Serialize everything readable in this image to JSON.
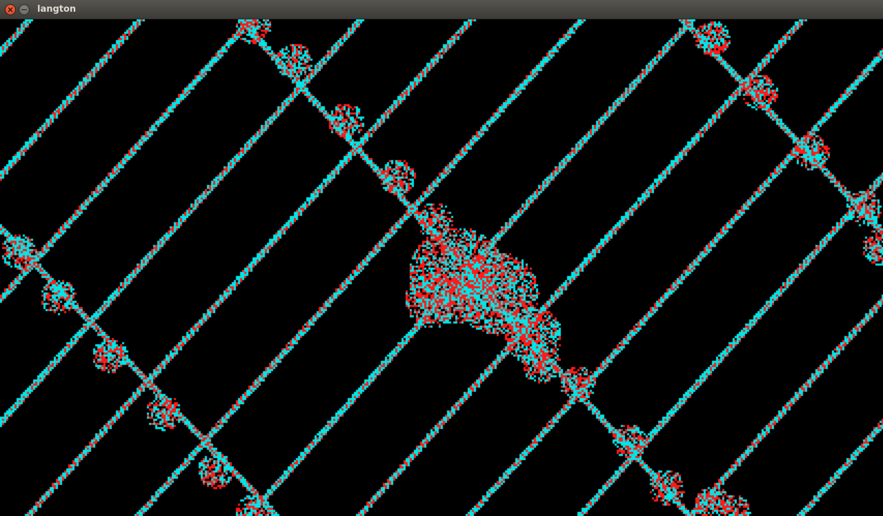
{
  "window": {
    "title": "langton",
    "close_icon": "close-icon",
    "minimize_icon": "minimize-icon"
  },
  "simulation": {
    "description_icon": "langtons-ant-grid",
    "background_color": "#000000",
    "cell_colors": [
      "#ff1a1a",
      "#00e5e5"
    ],
    "titlebar_color": "#3c3b37",
    "close_button_color": "#e05a2b"
  }
}
